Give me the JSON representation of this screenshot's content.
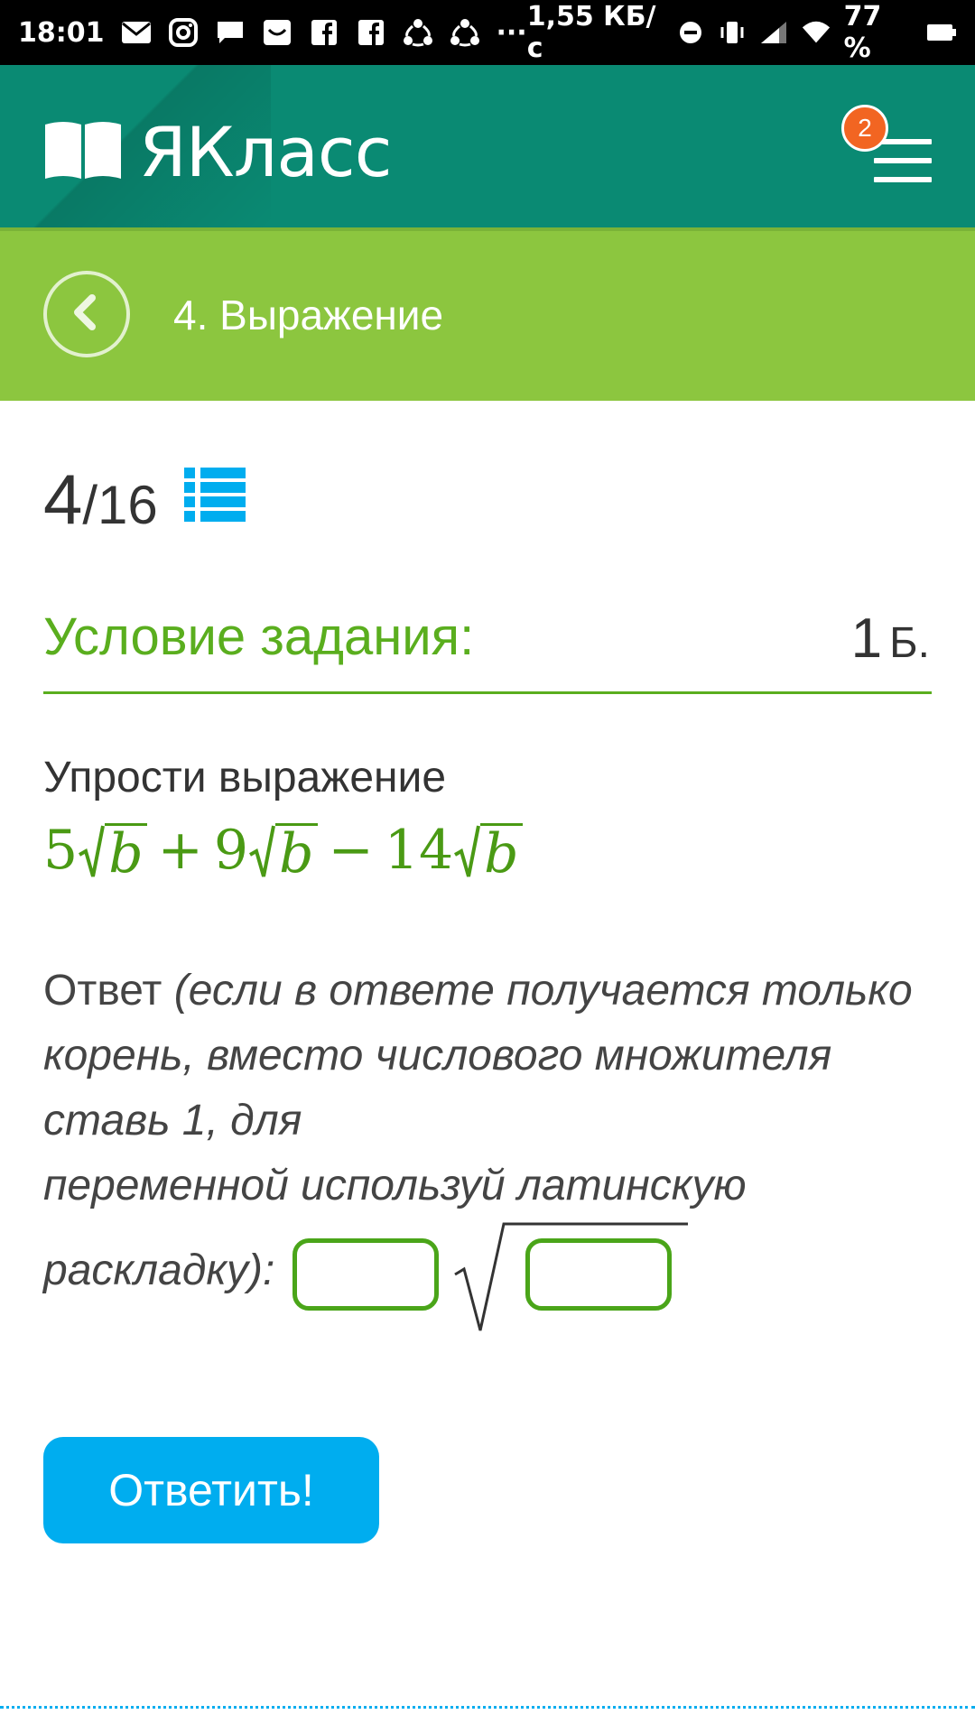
{
  "status_bar": {
    "time": "18:01",
    "net_speed": "1,55 КБ/с",
    "battery": "77 %",
    "more": "···"
  },
  "header": {
    "logo_text": "ЯКласс",
    "notification_count": "2"
  },
  "lesson": {
    "title": "4. Выражение"
  },
  "progress": {
    "current": "4",
    "total": "/16"
  },
  "task": {
    "section_title": "Условие задания:",
    "points_value": "1",
    "points_unit": "Б.",
    "prompt": "Упрости выражение",
    "expression": {
      "c1": "5",
      "var": "b",
      "op1": "+",
      "c2": "9",
      "op2": "−",
      "c3": "14"
    },
    "answer_label": "Ответ ",
    "answer_hint_1": "(если в ответе получается только корень, вместо числового множителя ставь 1, для",
    "answer_hint_2": "переменной используй латинскую",
    "answer_hint_3": "раскладку):",
    "coef_value": "",
    "radicand_value": ""
  },
  "actions": {
    "submit_label": "Ответить!"
  },
  "colors": {
    "header": "#0a8a73",
    "lesson_bar": "#8cc63f",
    "accent_green": "#5aae1e",
    "submit": "#00adef",
    "badge": "#f26522"
  }
}
